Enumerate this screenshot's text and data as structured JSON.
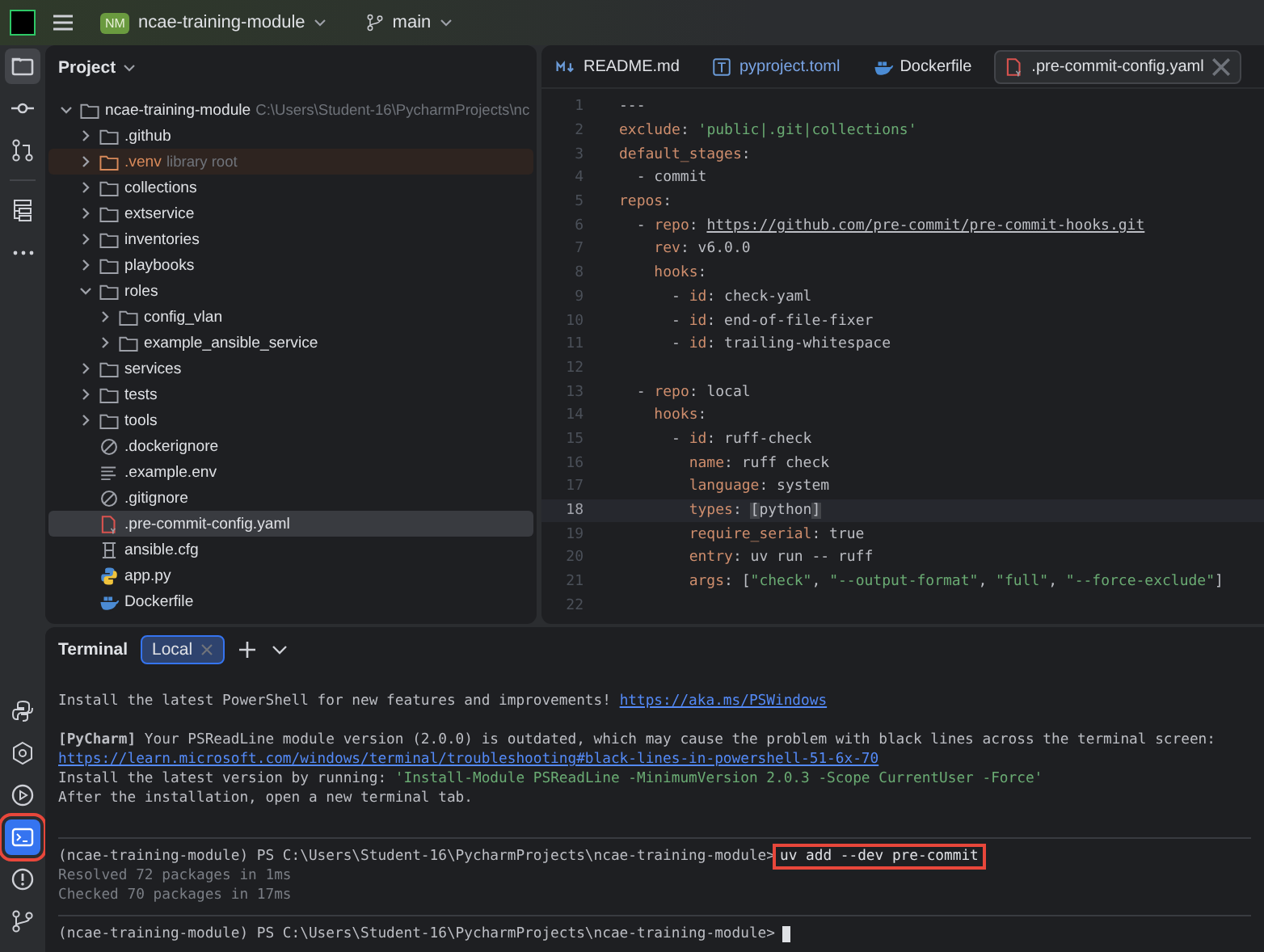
{
  "title_bar": {
    "project": "ncae-training-module",
    "project_badge": "NM",
    "branch": "main"
  },
  "left_toolbar": [
    {
      "kind": "folder",
      "selected": true
    },
    {
      "kind": "commit",
      "selected": false
    },
    {
      "kind": "pull",
      "selected": false
    },
    {
      "kind": "structure",
      "selected": false
    },
    {
      "kind": "more",
      "selected": false
    }
  ],
  "bottom_toolbar": [
    {
      "kind": "python",
      "selected": false,
      "highlighted": false
    },
    {
      "kind": "services",
      "selected": false,
      "highlighted": false
    },
    {
      "kind": "run",
      "selected": false,
      "highlighted": false
    },
    {
      "kind": "terminal",
      "selected": true,
      "highlighted": true
    },
    {
      "kind": "problems",
      "selected": false,
      "highlighted": false
    },
    {
      "kind": "git",
      "selected": false,
      "highlighted": false
    }
  ],
  "project_panel": {
    "title": "Project",
    "tree": [
      {
        "name": "ncae-training-module",
        "kind": "folder",
        "expanded": true,
        "selected": false,
        "hint": "C:\\Users\\Student-16\\PycharmProjects\\nc",
        "children": [
          {
            "name": ".github",
            "kind": "folder",
            "expanded": false,
            "selected": false
          },
          {
            "name": ".venv",
            "kind": "excluded",
            "expanded": false,
            "selected": false,
            "hint": "library root"
          },
          {
            "name": "collections",
            "kind": "folder",
            "expanded": false,
            "selected": false
          },
          {
            "name": "extservice",
            "kind": "folder",
            "expanded": false,
            "selected": false
          },
          {
            "name": "inventories",
            "kind": "folder",
            "expanded": false,
            "selected": false
          },
          {
            "name": "playbooks",
            "kind": "folder",
            "expanded": false,
            "selected": false
          },
          {
            "name": "roles",
            "kind": "folder",
            "expanded": true,
            "selected": false,
            "children": [
              {
                "name": "config_vlan",
                "kind": "folder",
                "expanded": false,
                "selected": false
              },
              {
                "name": "example_ansible_service",
                "kind": "folder",
                "expanded": false,
                "selected": false
              }
            ]
          },
          {
            "name": "services",
            "kind": "folder",
            "expanded": false,
            "selected": false
          },
          {
            "name": "tests",
            "kind": "folder",
            "expanded": false,
            "selected": false
          },
          {
            "name": "tools",
            "kind": "folder",
            "expanded": false,
            "selected": false
          },
          {
            "name": ".dockerignore",
            "kind": "ignore",
            "selected": false
          },
          {
            "name": ".example.env",
            "kind": "text",
            "selected": false
          },
          {
            "name": ".gitignore",
            "kind": "ignore",
            "selected": false
          },
          {
            "name": ".pre-commit-config.yaml",
            "kind": "yaml",
            "selected": true
          },
          {
            "name": "ansible.cfg",
            "kind": "config",
            "selected": false
          },
          {
            "name": "app.py",
            "kind": "python",
            "selected": false
          },
          {
            "name": "Dockerfile",
            "kind": "docker",
            "selected": false
          }
        ]
      }
    ]
  },
  "editor": {
    "tabs": [
      {
        "label": "README.md",
        "kind": "markdown",
        "selected": false
      },
      {
        "label": "pyproject.toml",
        "kind": "toml",
        "selected": false
      },
      {
        "label": "Dockerfile",
        "kind": "docker",
        "selected": false
      },
      {
        "label": ".pre-commit-config.yaml",
        "kind": "yaml",
        "selected": true
      }
    ],
    "lines": [
      {
        "number": "1",
        "current": false,
        "tokens": [
          {
            "kind": "plain",
            "text": "---"
          }
        ]
      },
      {
        "number": "2",
        "current": false,
        "tokens": [
          {
            "kind": "key",
            "text": "exclude"
          },
          {
            "kind": "plain",
            "text": ": "
          },
          {
            "kind": "string",
            "text": "'public|.git|collections'"
          }
        ]
      },
      {
        "number": "3",
        "current": false,
        "tokens": [
          {
            "kind": "key",
            "text": "default_stages"
          },
          {
            "kind": "plain",
            "text": ":"
          }
        ]
      },
      {
        "number": "4",
        "current": false,
        "tokens": [
          {
            "kind": "plain",
            "text": "  - commit"
          }
        ]
      },
      {
        "number": "5",
        "current": false,
        "tokens": [
          {
            "kind": "key",
            "text": "repos"
          },
          {
            "kind": "plain",
            "text": ":"
          }
        ]
      },
      {
        "number": "6",
        "current": false,
        "tokens": [
          {
            "kind": "plain",
            "text": "  - "
          },
          {
            "kind": "key",
            "text": "repo"
          },
          {
            "kind": "plain",
            "text": ": "
          },
          {
            "kind": "link",
            "text": "https://github.com/pre-commit/pre-commit-hooks.git"
          }
        ]
      },
      {
        "number": "7",
        "current": false,
        "tokens": [
          {
            "kind": "key",
            "text": "    rev"
          },
          {
            "kind": "plain",
            "text": ": v6.0.0"
          }
        ]
      },
      {
        "number": "8",
        "current": false,
        "tokens": [
          {
            "kind": "key",
            "text": "    hooks"
          },
          {
            "kind": "plain",
            "text": ":"
          }
        ]
      },
      {
        "number": "9",
        "current": false,
        "tokens": [
          {
            "kind": "plain",
            "text": "      - "
          },
          {
            "kind": "key",
            "text": "id"
          },
          {
            "kind": "plain",
            "text": ": check-yaml"
          }
        ]
      },
      {
        "number": "10",
        "current": false,
        "tokens": [
          {
            "kind": "plain",
            "text": "      - "
          },
          {
            "kind": "key",
            "text": "id"
          },
          {
            "kind": "plain",
            "text": ": end-of-file-fixer"
          }
        ]
      },
      {
        "number": "11",
        "current": false,
        "tokens": [
          {
            "kind": "plain",
            "text": "      - "
          },
          {
            "kind": "key",
            "text": "id"
          },
          {
            "kind": "plain",
            "text": ": trailing-whitespace"
          }
        ]
      },
      {
        "number": "12",
        "current": false
      },
      {
        "number": "13",
        "current": false,
        "tokens": [
          {
            "kind": "plain",
            "text": "  - "
          },
          {
            "kind": "key",
            "text": "repo"
          },
          {
            "kind": "plain",
            "text": ": local"
          }
        ]
      },
      {
        "number": "14",
        "current": false,
        "tokens": [
          {
            "kind": "key",
            "text": "    hooks"
          },
          {
            "kind": "plain",
            "text": ":"
          }
        ]
      },
      {
        "number": "15",
        "current": false,
        "tokens": [
          {
            "kind": "plain",
            "text": "      - "
          },
          {
            "kind": "key",
            "text": "id"
          },
          {
            "kind": "plain",
            "text": ": ruff-check"
          }
        ]
      },
      {
        "number": "16",
        "current": false,
        "tokens": [
          {
            "kind": "key",
            "text": "        name"
          },
          {
            "kind": "plain",
            "text": ": ruff check"
          }
        ]
      },
      {
        "number": "17",
        "current": false,
        "tokens": [
          {
            "kind": "key",
            "text": "        language"
          },
          {
            "kind": "plain",
            "text": ": system"
          }
        ]
      },
      {
        "number": "18",
        "current": true,
        "tokens": [
          {
            "kind": "key",
            "text": "        types"
          },
          {
            "kind": "plain",
            "text": ": "
          },
          {
            "kind": "bracket",
            "text": "["
          },
          {
            "kind": "plain",
            "text": "python"
          },
          {
            "kind": "bracket",
            "text": "]"
          }
        ]
      },
      {
        "number": "19",
        "current": false,
        "tokens": [
          {
            "kind": "key",
            "text": "        require_serial"
          },
          {
            "kind": "plain",
            "text": ": true"
          }
        ]
      },
      {
        "number": "20",
        "current": false,
        "tokens": [
          {
            "kind": "key",
            "text": "        entry"
          },
          {
            "kind": "plain",
            "text": ": uv run -- ruff"
          }
        ]
      },
      {
        "number": "21",
        "current": false,
        "tokens": [
          {
            "kind": "key",
            "text": "        args"
          },
          {
            "kind": "plain",
            "text": ": ["
          },
          {
            "kind": "string",
            "text": "\"check\""
          },
          {
            "kind": "plain",
            "text": ", "
          },
          {
            "kind": "string",
            "text": "\"--output-format\""
          },
          {
            "kind": "plain",
            "text": ", "
          },
          {
            "kind": "string",
            "text": "\"full\""
          },
          {
            "kind": "plain",
            "text": ", "
          },
          {
            "kind": "string",
            "text": "\"--force-exclude\""
          },
          {
            "kind": "plain",
            "text": "]"
          }
        ]
      },
      {
        "number": "22",
        "current": false
      }
    ]
  },
  "terminal": {
    "title": "Terminal",
    "tabs": [
      {
        "label": "Local",
        "selected": true
      }
    ],
    "lines": [
      {
        "separator": false,
        "tokens": [
          {
            "kind": "plain",
            "text": "Install the latest PowerShell for new features and improvements! "
          },
          {
            "kind": "link",
            "text": "https://aka.ms/PSWindows"
          }
        ]
      },
      {
        "separator": false
      },
      {
        "separator": false,
        "tokens": [
          {
            "kind": "plain",
            "text": "**[PyCharm]** Your PSReadLine module version (2.0.0) is outdated, which may cause the problem with black lines across the terminal screen:"
          }
        ]
      },
      {
        "separator": false,
        "tokens": [
          {
            "kind": "link",
            "text": "https://learn.microsoft.com/windows/terminal/troubleshooting#black-lines-in-powershell-51-6x-70"
          }
        ]
      },
      {
        "separator": false,
        "tokens": [
          {
            "kind": "plain",
            "text": "Install the latest version by running: "
          },
          {
            "kind": "string",
            "text": "'Install-Module PSReadLine -MinimumVersion 2.0.3 -Scope CurrentUser -Force'"
          }
        ]
      },
      {
        "separator": false,
        "tokens": [
          {
            "kind": "plain",
            "text": "After the installation, open a new terminal tab."
          }
        ]
      },
      {
        "separator": false
      },
      {
        "separator": true,
        "tokens": [
          {
            "kind": "plain",
            "text": "(ncae-training-module) PS C:\\Users\\Student-16\\PycharmProjects\\ncae-training-module>"
          },
          {
            "kind": "command",
            "text": "uv add --dev pre-commit",
            "highlighted": true
          }
        ]
      },
      {
        "separator": false,
        "tokens": [
          {
            "kind": "dim",
            "text": "Resolved 72 packages in 1ms"
          }
        ]
      },
      {
        "separator": false,
        "tokens": [
          {
            "kind": "dim",
            "text": "Checked 70 packages in 17ms"
          }
        ]
      },
      {
        "separator": true,
        "tokens": [
          {
            "kind": "plain",
            "text": "(ncae-training-module) PS C:\\Users\\Student-16\\PycharmProjects\\ncae-training-module>"
          },
          {
            "kind": "cursor"
          }
        ]
      }
    ]
  }
}
